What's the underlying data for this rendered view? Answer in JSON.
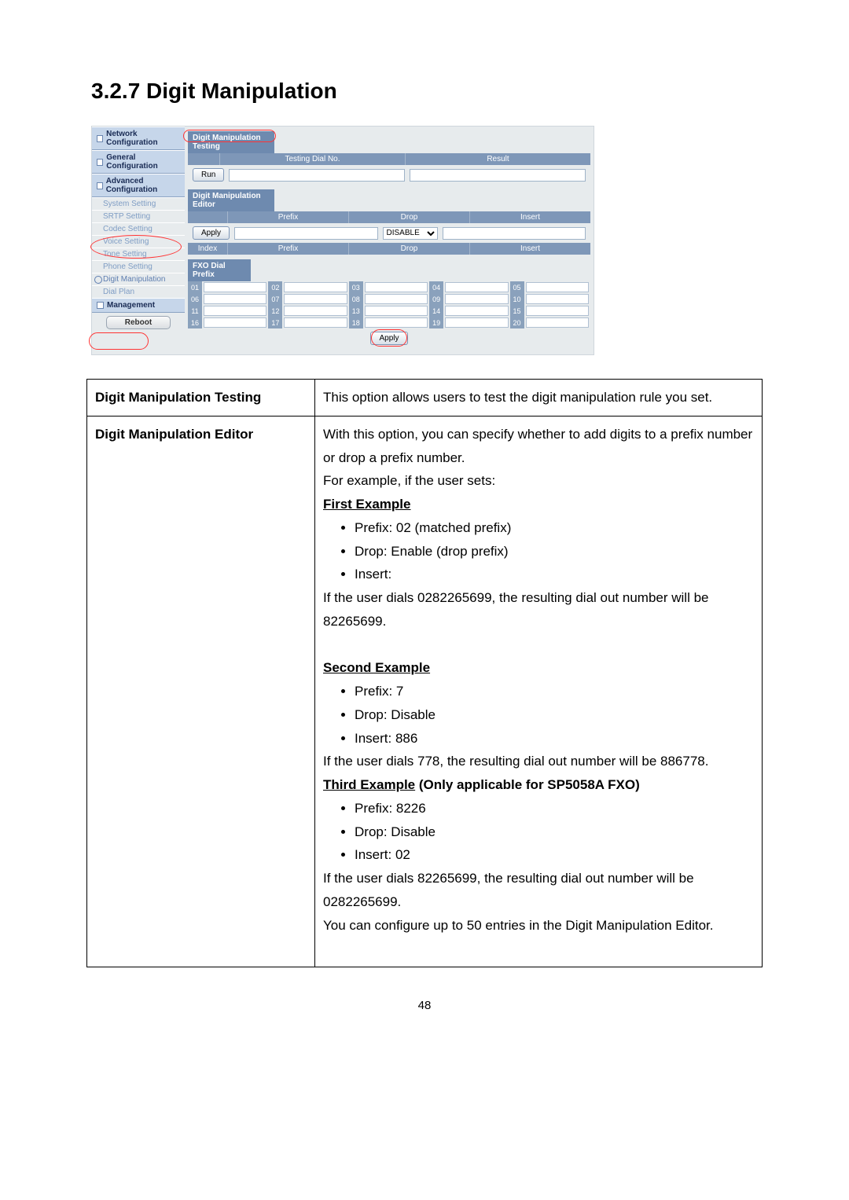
{
  "section_heading": "3.2.7  Digit Manipulation",
  "sidebar": {
    "categories": [
      {
        "label": "Network Configuration",
        "subs": []
      },
      {
        "label": "General Configuration",
        "subs": []
      },
      {
        "label": "Advanced Configuration",
        "subs": [
          {
            "label": "System Setting"
          },
          {
            "label": "SRTP Setting"
          },
          {
            "label": "Codec Setting"
          },
          {
            "label": "Voice Setting"
          },
          {
            "label": "Tone Setting"
          },
          {
            "label": "Phone Setting"
          },
          {
            "label": "Digit Manipulation",
            "active": true
          },
          {
            "label": "Dial Plan"
          }
        ]
      },
      {
        "label": "Management",
        "subs": []
      }
    ],
    "reboot_label": "Reboot"
  },
  "testing_panel": {
    "title": "Digit Manipulation Testing",
    "col_test": "Testing Dial No.",
    "col_result": "Result",
    "run_label": "Run"
  },
  "editor_panel": {
    "title": "Digit Manipulation Editor",
    "col_prefix": "Prefix",
    "col_drop": "Drop",
    "col_insert": "Insert",
    "apply_label": "Apply",
    "drop_value": "DISABLE",
    "col_index": "Index"
  },
  "fxo_panel": {
    "title": "FXO Dial Prefix",
    "rows": [
      [
        "01",
        "02",
        "03",
        "04",
        "05"
      ],
      [
        "06",
        "07",
        "08",
        "09",
        "10"
      ],
      [
        "11",
        "12",
        "13",
        "14",
        "15"
      ],
      [
        "16",
        "17",
        "18",
        "19",
        "20"
      ]
    ],
    "apply_label": "Apply"
  },
  "desc_table": {
    "row1": {
      "name": "Digit Manipulation Testing",
      "body": "This option allows users to test the digit manipulation rule you set."
    },
    "row2": {
      "name": "Digit Manipulation Editor",
      "intro1": "With this option, you can specify whether to add digits to a prefix number or drop a prefix number.",
      "intro2": "For example, if the user sets:",
      "ex1_title": "First Example",
      "ex1_b1": "Prefix: 02 (matched prefix)",
      "ex1_b2": "Drop: Enable (drop prefix)",
      "ex1_b3": "Insert:",
      "ex1_after": "If the user dials 0282265699, the resulting dial out number will be 82265699.",
      "ex2_title": "Second Example",
      "ex2_b1": "Prefix: 7",
      "ex2_b2": "Drop: Disable",
      "ex2_b3": "Insert: 886",
      "ex2_after": "If the user dials 778, the resulting dial out number will be 886778.",
      "ex3_title_u": "Third Example",
      "ex3_title_rest": " (Only applicable for SP5058A FXO)",
      "ex3_b1": "Prefix: 8226",
      "ex3_b2": "Drop: Disable",
      "ex3_b3": "Insert: 02",
      "ex3_after": "If the user dials 82265699, the resulting dial out number will be 0282265699.",
      "outro": "You can configure up to 50 entries in the Digit Manipulation Editor."
    }
  },
  "page_number": "48"
}
